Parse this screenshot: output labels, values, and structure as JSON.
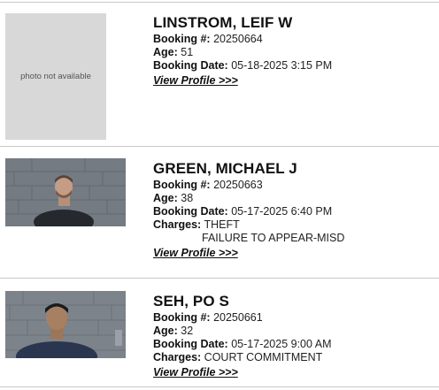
{
  "labels": {
    "booking": "Booking #:",
    "age": "Age:",
    "booking_date": "Booking Date:",
    "charges": "Charges:",
    "view_profile": "View Profile >>>",
    "no_photo": "photo not available"
  },
  "records": [
    {
      "name": "LINSTROM, LEIF W",
      "booking": "20250664",
      "age": "51",
      "booking_date": "05-18-2025 3:15 PM",
      "charges": []
    },
    {
      "name": "GREEN, MICHAEL J",
      "booking": "20250663",
      "age": "38",
      "booking_date": "05-17-2025 6:40 PM",
      "charges": [
        "THEFT",
        "FAILURE TO APPEAR-MISD"
      ]
    },
    {
      "name": "SEH, PO S",
      "booking": "20250661",
      "age": "32",
      "booking_date": "05-17-2025 9:00 AM",
      "charges": [
        "COURT COMMITMENT"
      ]
    }
  ]
}
